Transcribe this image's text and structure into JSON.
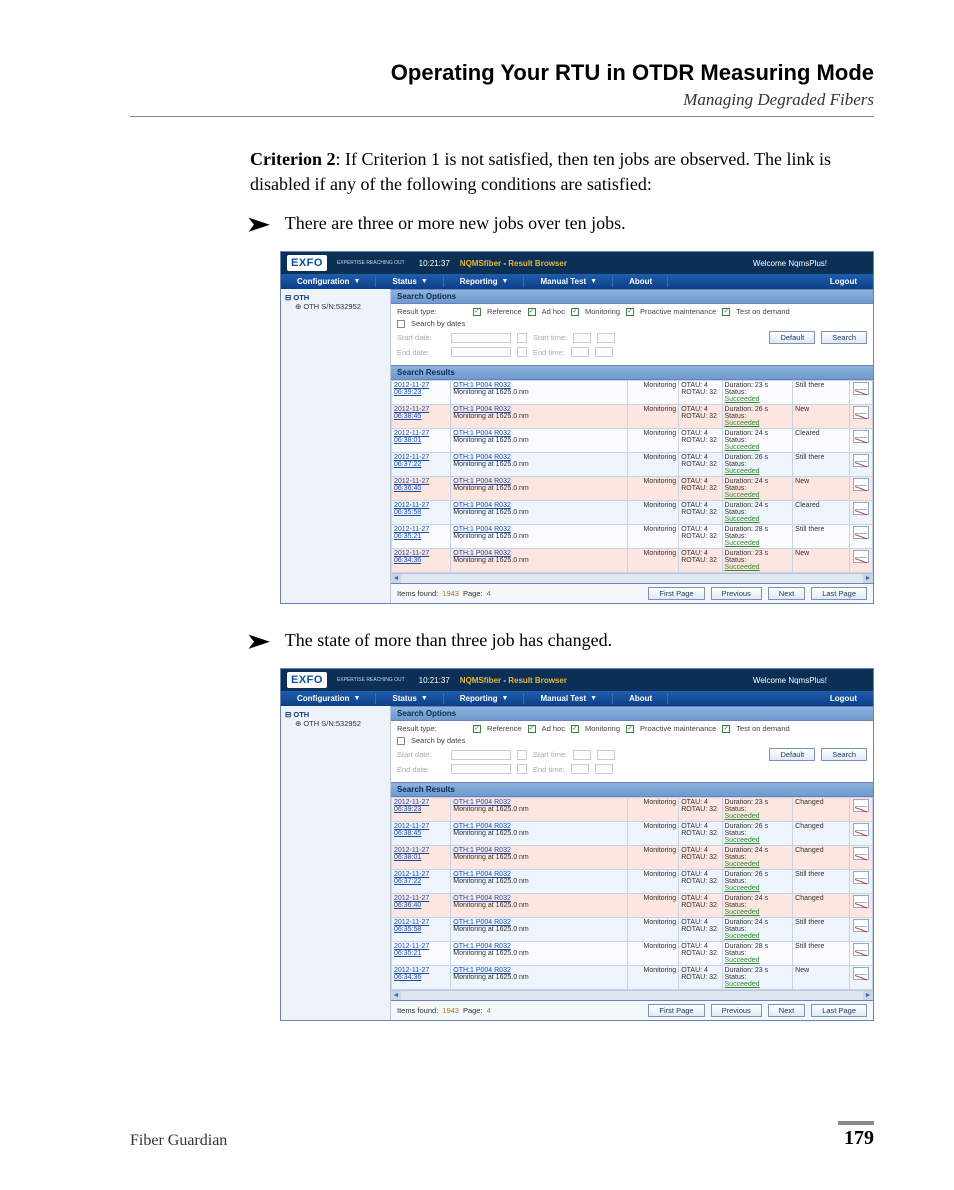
{
  "header": {
    "chapter": "Operating Your RTU in OTDR Measuring Mode",
    "section": "Managing Degraded Fibers"
  },
  "para_criterion2_label": "Criterion 2",
  "para_criterion2_text": ": If Criterion 1 is not satisfied, then ten jobs are observed. The link is disabled if any of the following conditions are satisfied:",
  "bullet1": "There are three or more new jobs over ten jobs.",
  "bullet2": "The state of more than three job has changed.",
  "app": {
    "logo": "EXFO",
    "logo_sub": "EXPERTISE REACHING OUT",
    "time": "10:21:37",
    "title1": "NQMSfiber",
    "title_sep": " - ",
    "title2": "Result Browser",
    "welcome": "Welcome NqmsPlus!",
    "menu": [
      "Configuration",
      "Status",
      "Reporting",
      "Manual Test",
      "About",
      "Logout"
    ],
    "tree_root": "OTH",
    "tree_child": "OTH S/N:532952",
    "panel_search_options": "Search Options",
    "result_type_label": "Result type:",
    "checks": [
      "Reference",
      "Ad hoc",
      "Monitoring",
      "Proactive maintenance",
      "Test on demand"
    ],
    "search_by_dates": "Search by dates",
    "start_date": "Start date:",
    "end_date": "End date:",
    "start_time": "Start time:",
    "end_time": "End time:",
    "btn_default": "Default",
    "btn_search": "Search",
    "panel_search_results": "Search Results",
    "rows1": [
      {
        "dt": "2012-11-27 06:39:23",
        "desc": "OTH:1 P004 R032",
        "sub": "Monitoring at 1625.0 nm",
        "mon": "Monitoring",
        "otau": "OTAU: 4",
        "rotau": "ROTAU: 32",
        "dur": "Duration: 23 s",
        "st": "Status:",
        "succ": "Succeeded",
        "state": "Still there",
        "hot": false,
        "alt": false
      },
      {
        "dt": "2012-11-27 06:38:45",
        "desc": "OTH:1 P004 R032",
        "sub": "Monitoring at 1625.0 nm",
        "mon": "Monitoring",
        "otau": "OTAU: 4",
        "rotau": "ROTAU: 32",
        "dur": "Duration: 26 s",
        "st": "Status:",
        "succ": "Succeeded",
        "state": "New",
        "hot": true,
        "alt": true
      },
      {
        "dt": "2012-11-27 06:38:01",
        "desc": "OTH:1 P004 R032",
        "sub": "Monitoring at 1625.0 nm",
        "mon": "Monitoring",
        "otau": "OTAU: 4",
        "rotau": "ROTAU: 32",
        "dur": "Duration: 24 s",
        "st": "Status:",
        "succ": "Succeeded",
        "state": "Cleared",
        "hot": false,
        "alt": false
      },
      {
        "dt": "2012-11-27 06:37:22",
        "desc": "OTH:1 P004 R032",
        "sub": "Monitoring at 1625.0 nm",
        "mon": "Monitoring",
        "otau": "OTAU: 4",
        "rotau": "ROTAU: 32",
        "dur": "Duration: 26 s",
        "st": "Status:",
        "succ": "Succeeded",
        "state": "Still there",
        "hot": false,
        "alt": true
      },
      {
        "dt": "2012-11-27 06:36:40",
        "desc": "OTH:1 P004 R032",
        "sub": "Monitoring at 1625.0 nm",
        "mon": "Monitoring",
        "otau": "OTAU: 4",
        "rotau": "ROTAU: 32",
        "dur": "Duration: 24 s",
        "st": "Status:",
        "succ": "Succeeded",
        "state": "New",
        "hot": true,
        "alt": false
      },
      {
        "dt": "2012-11-27 06:35:58",
        "desc": "OTH:1 P004 R032",
        "sub": "Monitoring at 1625.0 nm",
        "mon": "Monitoring",
        "otau": "OTAU: 4",
        "rotau": "ROTAU: 32",
        "dur": "Duration: 24 s",
        "st": "Status:",
        "succ": "Succeeded",
        "state": "Cleared",
        "hot": false,
        "alt": true
      },
      {
        "dt": "2012-11-27 06:35:21",
        "desc": "OTH:1 P004 R032",
        "sub": "Monitoring at 1625.0 nm",
        "mon": "Monitoring",
        "otau": "OTAU: 4",
        "rotau": "ROTAU: 32",
        "dur": "Duration: 28 s",
        "st": "Status:",
        "succ": "Succeeded",
        "state": "Still there",
        "hot": false,
        "alt": false
      },
      {
        "dt": "2012-11-27 06:34:36",
        "desc": "OTH:1 P004 R032",
        "sub": "Monitoring at 1625.0 nm",
        "mon": "Monitoring",
        "otau": "OTAU: 4",
        "rotau": "ROTAU: 32",
        "dur": "Duration: 23 s",
        "st": "Status:",
        "succ": "Succeeded",
        "state": "New",
        "hot": true,
        "alt": true
      }
    ],
    "rows2": [
      {
        "dt": "2012-11-27 06:39:23",
        "desc": "OTH:1 P004 R032",
        "sub": "Monitoring at 1625.0 nm",
        "mon": "Monitoring",
        "otau": "OTAU: 4",
        "rotau": "ROTAU: 32",
        "dur": "Duration: 23 s",
        "st": "Status:",
        "succ": "Succeeded",
        "state": "Changed",
        "hot": true,
        "alt": false
      },
      {
        "dt": "2012-11-27 06:38:45",
        "desc": "OTH:1 P004 R032",
        "sub": "Monitoring at 1625.0 nm",
        "mon": "Monitoring",
        "otau": "OTAU: 4",
        "rotau": "ROTAU: 32",
        "dur": "Duration: 26 s",
        "st": "Status:",
        "succ": "Succeeded",
        "state": "Changed",
        "hot": false,
        "alt": true
      },
      {
        "dt": "2012-11-27 06:38:01",
        "desc": "OTH:1 P004 R032",
        "sub": "Monitoring at 1625.0 nm",
        "mon": "Monitoring",
        "otau": "OTAU: 4",
        "rotau": "ROTAU: 32",
        "dur": "Duration: 24 s",
        "st": "Status:",
        "succ": "Succeeded",
        "state": "Changed",
        "hot": true,
        "alt": false
      },
      {
        "dt": "2012-11-27 06:37:22",
        "desc": "OTH:1 P004 R032",
        "sub": "Monitoring at 1625.0 nm",
        "mon": "Monitoring",
        "otau": "OTAU: 4",
        "rotau": "ROTAU: 32",
        "dur": "Duration: 26 s",
        "st": "Status:",
        "succ": "Succeeded",
        "state": "Still there",
        "hot": false,
        "alt": true
      },
      {
        "dt": "2012-11-27 06:36:40",
        "desc": "OTH:1 P004 R032",
        "sub": "Monitoring at 1625.0 nm",
        "mon": "Monitoring",
        "otau": "OTAU: 4",
        "rotau": "ROTAU: 32",
        "dur": "Duration: 24 s",
        "st": "Status:",
        "succ": "Succeeded",
        "state": "Changed",
        "hot": true,
        "alt": false
      },
      {
        "dt": "2012-11-27 06:35:58",
        "desc": "OTH:1 P004 R032",
        "sub": "Monitoring at 1625.0 nm",
        "mon": "Monitoring",
        "otau": "OTAU: 4",
        "rotau": "ROTAU: 32",
        "dur": "Duration: 24 s",
        "st": "Status:",
        "succ": "Succeeded",
        "state": "Still there",
        "hot": false,
        "alt": true
      },
      {
        "dt": "2012-11-27 06:35:21",
        "desc": "OTH:1 P004 R032",
        "sub": "Monitoring at 1625.0 nm",
        "mon": "Monitoring",
        "otau": "OTAU: 4",
        "rotau": "ROTAU: 32",
        "dur": "Duration: 28 s",
        "st": "Status:",
        "succ": "Succeeded",
        "state": "Still there",
        "hot": false,
        "alt": false
      },
      {
        "dt": "2012-11-27 06:34:36",
        "desc": "OTH:1 P004 R032",
        "sub": "Monitoring at 1625.0 nm",
        "mon": "Monitoring",
        "otau": "OTAU: 4",
        "rotau": "ROTAU: 32",
        "dur": "Duration: 23 s",
        "st": "Status:",
        "succ": "Succeeded",
        "state": "New",
        "hot": false,
        "alt": true
      }
    ],
    "footer_items_label": "Items found:",
    "footer_items_val": "1943",
    "footer_page_label": "Page:",
    "footer_page_val": "4",
    "pager": [
      "First Page",
      "Previous",
      "Next",
      "Last Page"
    ]
  },
  "pagefoot": {
    "product": "Fiber Guardian",
    "page": "179"
  }
}
